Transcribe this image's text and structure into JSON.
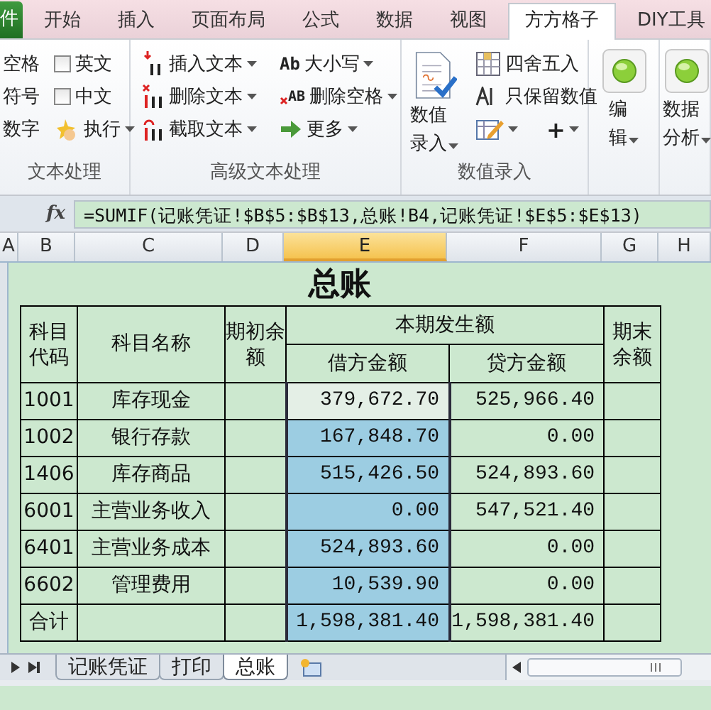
{
  "ribbon_tabs": [
    {
      "label": "件",
      "kind": "file",
      "selected": false
    },
    {
      "label": "开始",
      "kind": "tab",
      "selected": false
    },
    {
      "label": "插入",
      "kind": "tab",
      "selected": false
    },
    {
      "label": "页面布局",
      "kind": "tab",
      "selected": false
    },
    {
      "label": "公式",
      "kind": "tab",
      "selected": false
    },
    {
      "label": "数据",
      "kind": "tab",
      "selected": false
    },
    {
      "label": "视图",
      "kind": "tab",
      "selected": false
    },
    {
      "label": "方方格子",
      "kind": "tab",
      "selected": true
    },
    {
      "label": "DIY工具",
      "kind": "tab",
      "selected": false
    }
  ],
  "ribbon_groups": [
    {
      "label": "文本处理",
      "columns": [
        [
          {
            "kind": "text",
            "label": "空格"
          },
          {
            "kind": "text",
            "label": "符号"
          },
          {
            "kind": "text",
            "label": "数字"
          }
        ],
        [
          {
            "kind": "checkbox",
            "label": "英文",
            "checked": false
          },
          {
            "kind": "checkbox",
            "label": "中文",
            "checked": false
          },
          {
            "kind": "small",
            "label": "执行",
            "dropdown": true
          }
        ]
      ]
    },
    {
      "label": "高级文本处理",
      "columns": [
        [
          {
            "kind": "small",
            "label": "插入文本",
            "dropdown": true
          },
          {
            "kind": "small",
            "label": "删除文本",
            "dropdown": true
          },
          {
            "kind": "small",
            "label": "截取文本",
            "dropdown": true
          }
        ],
        [
          {
            "kind": "small",
            "label": "大小写",
            "glyph": "Ab",
            "dropdown": true
          },
          {
            "kind": "small",
            "label": "删除空格",
            "glyph": "AB",
            "dropdown": true
          },
          {
            "kind": "small",
            "label": "更多",
            "dropdown": true
          }
        ]
      ]
    },
    {
      "label": "数值录入",
      "columns": [
        [
          {
            "kind": "large",
            "label": "数值录入",
            "dropdown": true
          }
        ],
        [
          {
            "kind": "small",
            "label": "四舍五入",
            "dropdown": false
          },
          {
            "kind": "small",
            "label": "只保留数值",
            "dropdown": false
          },
          {
            "kind": "pair",
            "items": [
              {
                "kind": "small",
                "dropdown": true
              },
              {
                "kind": "small",
                "label": "+",
                "dropdown": true
              }
            ]
          }
        ]
      ]
    },
    {
      "columns": [
        [
          {
            "kind": "large",
            "label": "编辑",
            "dropdown": true
          }
        ]
      ]
    },
    {
      "columns": [
        [
          {
            "kind": "large",
            "label": "数据分析",
            "dropdown": true
          }
        ]
      ]
    }
  ],
  "formula_bar": {
    "function_button": "fx",
    "formula": "=SUMIF(记账凭证!$B$5:$B$13,总账!B4,记账凭证!$E$5:$E$13)"
  },
  "columns": [
    {
      "label": "A",
      "selected": false
    },
    {
      "label": "B",
      "selected": false
    },
    {
      "label": "C",
      "selected": false
    },
    {
      "label": "D",
      "selected": false
    },
    {
      "label": "E",
      "selected": true
    },
    {
      "label": "F",
      "selected": false
    },
    {
      "label": "G",
      "selected": false
    },
    {
      "label": "H",
      "selected": false
    }
  ],
  "sheet": {
    "title": "总账",
    "headers": {
      "code": "科目代码",
      "name": "科目名称",
      "opening": "期初余额",
      "period": "本期发生额",
      "debit": "借方金额",
      "credit": "贷方金额",
      "closing": "期末余额"
    },
    "rows": [
      {
        "code": "1001",
        "name": "库存现金",
        "debit": "379,672.70",
        "credit": "525,966.40",
        "selected": true,
        "active": true
      },
      {
        "code": "1002",
        "name": "银行存款",
        "debit": "167,848.70",
        "credit": "0.00",
        "selected": true,
        "active": false
      },
      {
        "code": "1406",
        "name": "库存商品",
        "debit": "515,426.50",
        "credit": "524,893.60",
        "selected": true,
        "active": false
      },
      {
        "code": "6001",
        "name": "主营业务收入",
        "debit": "0.00",
        "credit": "547,521.40",
        "selected": true,
        "active": false
      },
      {
        "code": "6401",
        "name": "主营业务成本",
        "debit": "524,893.60",
        "credit": "0.00",
        "selected": true,
        "active": false
      },
      {
        "code": "6602",
        "name": "管理费用",
        "debit": "10,539.90",
        "credit": "0.00",
        "selected": true,
        "active": false
      },
      {
        "code": "合计",
        "debit": "1,598,381.40",
        "credit": "1,598,381.40",
        "selected": true,
        "active": false
      }
    ]
  },
  "sheet_tabs": [
    {
      "label": "记账凭证",
      "selected": false
    },
    {
      "label": "打印",
      "selected": false
    },
    {
      "label": "总账",
      "selected": true
    }
  ]
}
